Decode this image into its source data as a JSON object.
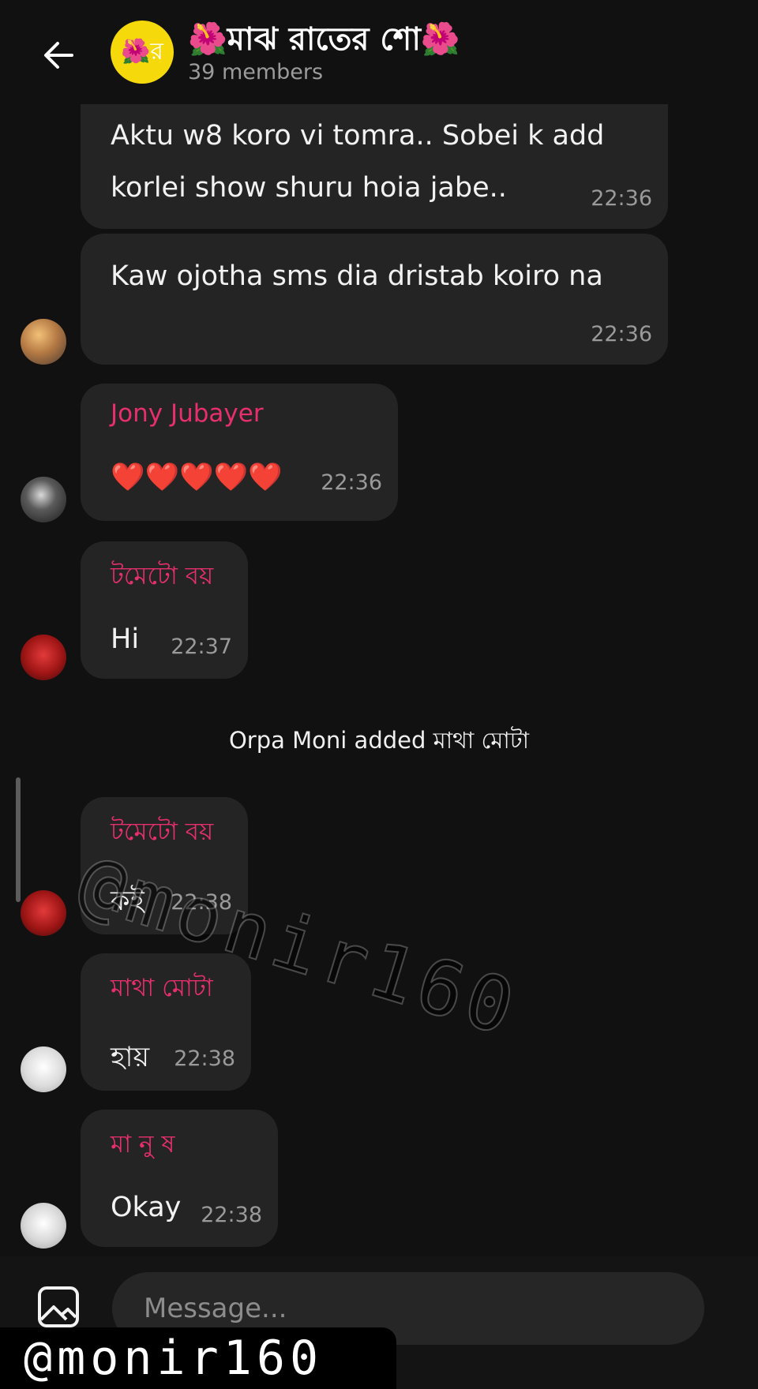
{
  "header": {
    "title": "🌺মাঝ রাতের শো🌺",
    "subtitle": "39 members",
    "avatar_text": "🌺র"
  },
  "messages": [
    {
      "text_line1": "Aktu w8 koro vi tomra.. Sobei k add",
      "text_line2": "korlei show shuru hoia jabe..",
      "time": "22:36"
    },
    {
      "text": "Kaw ojotha sms dia dristab koiro na",
      "time": "22:36"
    },
    {
      "sender": "Jony Jubayer",
      "text": "❤️❤️❤️❤️❤️",
      "time": "22:36"
    },
    {
      "sender": "টমেটো বয়",
      "text": "Hi",
      "time": "22:37"
    },
    {
      "sender": "টমেটো বয়",
      "text": "কই",
      "time": "22:38"
    },
    {
      "sender": "মাথা মোটা",
      "text": "হায়",
      "time": "22:38"
    },
    {
      "sender": "মা নু ষ",
      "text": "Okay",
      "time": "22:38"
    }
  ],
  "system_message": "Orpa Moni added মাথা মোটা",
  "composer": {
    "placeholder": "Message..."
  },
  "watermark": "@monir160",
  "colors": {
    "background": "#111111",
    "bubble": "#242424",
    "sender_name": "#e72f6d",
    "group_avatar": "#f5d90a"
  }
}
